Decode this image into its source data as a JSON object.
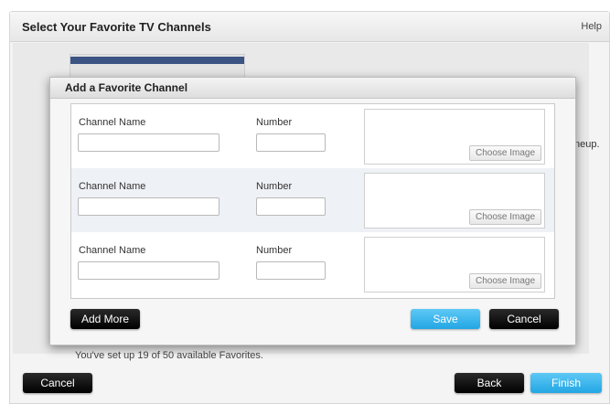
{
  "header": {
    "title": "Select Your Favorite TV Channels",
    "help_label": "Help"
  },
  "background": {
    "snippet": "neup.",
    "favorites_count": "You've set up 19 of 50 available Favorites."
  },
  "modal": {
    "title": "Add a Favorite Channel",
    "rows": [
      {
        "name_label": "Channel Name",
        "number_label": "Number",
        "name_value": "",
        "number_value": "",
        "choose_image_label": "Choose Image"
      },
      {
        "name_label": "Channel Name",
        "number_label": "Number",
        "name_value": "",
        "number_value": "",
        "choose_image_label": "Choose Image"
      },
      {
        "name_label": "Channel Name",
        "number_label": "Number",
        "name_value": "",
        "number_value": "",
        "choose_image_label": "Choose Image"
      }
    ],
    "add_more_label": "Add More",
    "save_label": "Save",
    "cancel_label": "Cancel"
  },
  "footer": {
    "cancel_label": "Cancel",
    "back_label": "Back",
    "finish_label": "Finish"
  },
  "colors": {
    "accent_blue": "#22a6e4",
    "dark_button": "#000000",
    "header_bar": "#3b5484"
  }
}
